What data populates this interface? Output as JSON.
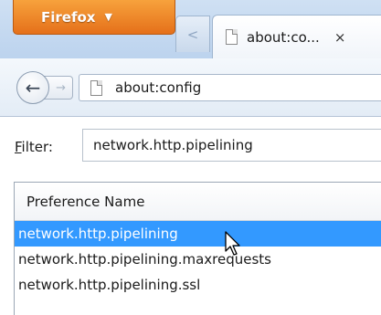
{
  "window": {
    "menu_button": "Firefox",
    "menu_arrow": "▼",
    "tab_scroll_arrow": "<",
    "tab": {
      "title": "about:co...",
      "close": "×"
    }
  },
  "navbar": {
    "back_icon": "←",
    "forward_icon": "→",
    "url": "about:config"
  },
  "filter": {
    "label_accesskey": "F",
    "label_rest": "ilter:",
    "value": "network.http.pipelining"
  },
  "table": {
    "column_header": "Preference Name",
    "rows": [
      {
        "name": "network.http.pipelining",
        "selected": true
      },
      {
        "name": "network.http.pipelining.maxrequests",
        "selected": false
      },
      {
        "name": "network.http.pipelining.ssl",
        "selected": false
      }
    ]
  },
  "colors": {
    "firefox_button": "#e5701a",
    "selection": "#3399ff",
    "chrome": "#cfe0f3"
  }
}
